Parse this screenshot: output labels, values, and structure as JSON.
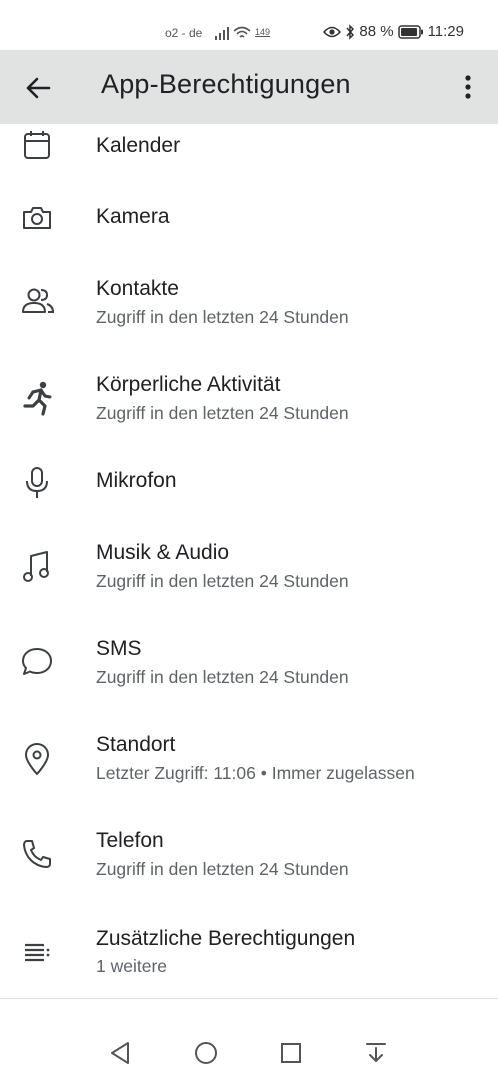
{
  "status_bar": {
    "carrier": "o2 - de",
    "data_speed": "149",
    "battery_percent": "88 %",
    "time": "11:29"
  },
  "app_bar": {
    "title": "App-Berechtigungen"
  },
  "permissions": [
    {
      "label": "Kalender",
      "sub": "",
      "icon": "calendar-icon"
    },
    {
      "label": "Kamera",
      "sub": "",
      "icon": "camera-icon"
    },
    {
      "label": "Kontakte",
      "sub": "Zugriff in den letzten 24 Stunden",
      "icon": "contacts-icon"
    },
    {
      "label": "Körperliche Aktivität",
      "sub": "Zugriff in den letzten 24 Stunden",
      "icon": "running-icon"
    },
    {
      "label": "Mikrofon",
      "sub": "",
      "icon": "microphone-icon"
    },
    {
      "label": "Musik & Audio",
      "sub": "Zugriff in den letzten 24 Stunden",
      "icon": "music-icon"
    },
    {
      "label": "SMS",
      "sub": "Zugriff in den letzten 24 Stunden",
      "icon": "sms-icon"
    },
    {
      "label": "Standort",
      "sub": "Letzter Zugriff: 11:06 • Immer zugelassen",
      "icon": "location-icon"
    },
    {
      "label": "Telefon",
      "sub": "Zugriff in den letzten 24 Stunden",
      "icon": "phone-icon"
    },
    {
      "label": "Zusätzliche Berechtigungen",
      "sub": "1 weitere",
      "icon": "list-icon"
    }
  ]
}
